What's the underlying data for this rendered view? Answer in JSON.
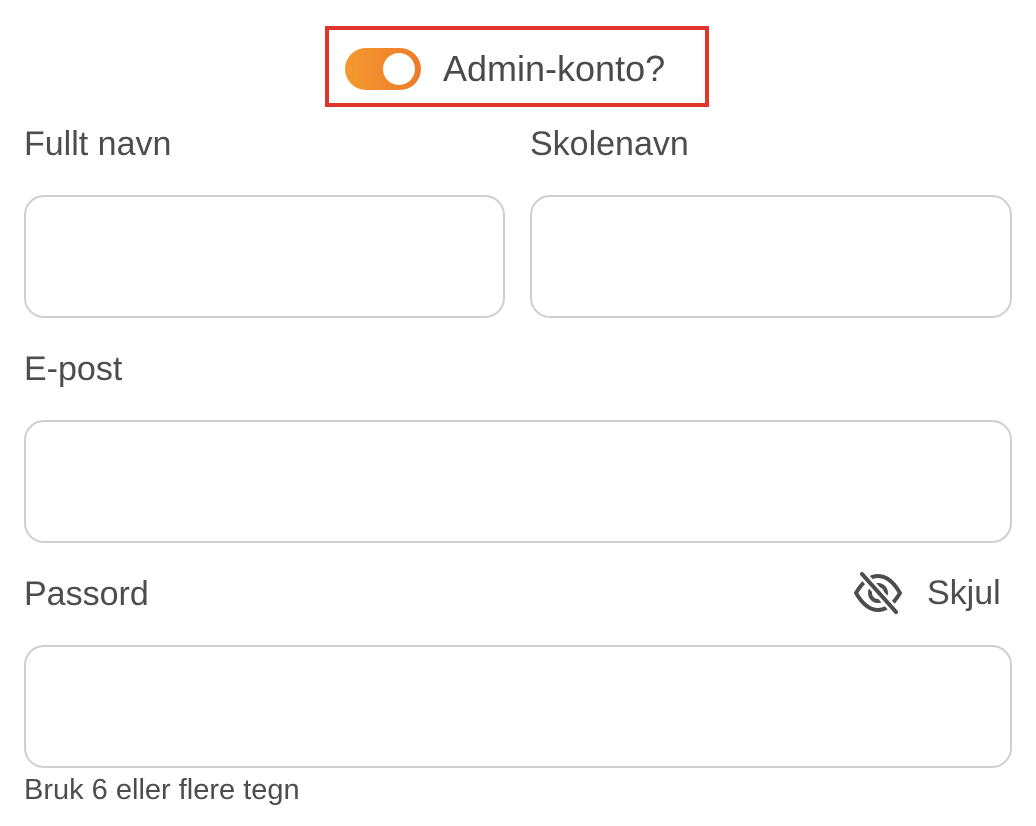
{
  "admin_toggle": {
    "label": "Admin-konto?",
    "checked": true,
    "accent_color": "#ee7b2a",
    "highlight_color": "#e0352b"
  },
  "fields": {
    "full_name": {
      "label": "Fullt navn",
      "value": ""
    },
    "school_name": {
      "label": "Skolenavn",
      "value": ""
    },
    "email": {
      "label": "E-post",
      "value": ""
    },
    "password": {
      "label": "Passord",
      "value": "",
      "visibility_label": "Skjul",
      "visibility_icon": "eye-slash-icon",
      "hint": "Bruk 6 eller flere tegn"
    }
  }
}
